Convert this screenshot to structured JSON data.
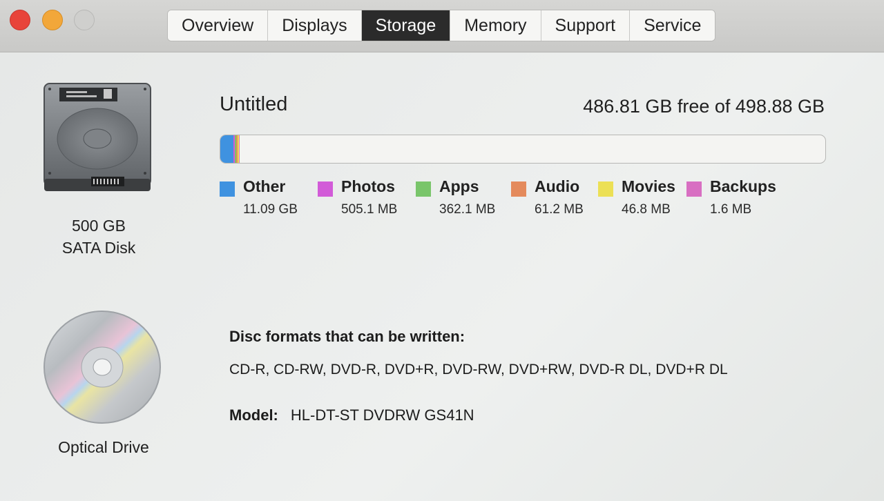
{
  "tabs": [
    {
      "label": "Overview",
      "active": false
    },
    {
      "label": "Displays",
      "active": false
    },
    {
      "label": "Storage",
      "active": true
    },
    {
      "label": "Memory",
      "active": false
    },
    {
      "label": "Support",
      "active": false
    },
    {
      "label": "Service",
      "active": false
    }
  ],
  "disk": {
    "line1": "500 GB",
    "line2": "SATA Disk",
    "icon": "hard-disk-icon"
  },
  "volume": {
    "name": "Untitled",
    "free_text": "486.81 GB free of 498.88 GB"
  },
  "usage": [
    {
      "name": "Other",
      "size": "11.09 GB",
      "color": "#3f92e0",
      "fraction": 0.0222
    },
    {
      "name": "Photos",
      "size": "505.1 MB",
      "color": "#d25bd8",
      "fraction": 0.001
    },
    {
      "name": "Apps",
      "size": "362.1 MB",
      "color": "#79c56a",
      "fraction": 0.0007
    },
    {
      "name": "Audio",
      "size": "61.2 MB",
      "color": "#e48a5c",
      "fraction": 0.0001
    },
    {
      "name": "Movies",
      "size": "46.8 MB",
      "color": "#ece055",
      "fraction": 0.0001
    },
    {
      "name": "Backups",
      "size": "1.6 MB",
      "color": "#d86fc2",
      "fraction": 0.0
    }
  ],
  "optical": {
    "label": "Optical Drive",
    "icon": "optical-disc-icon",
    "formats_title": "Disc formats that can be written:",
    "formats": "CD-R, CD-RW, DVD-R, DVD+R, DVD-RW, DVD+RW, DVD-R DL, DVD+R DL",
    "model_label": "Model:",
    "model_value": "HL-DT-ST DVDRW GS41N"
  }
}
